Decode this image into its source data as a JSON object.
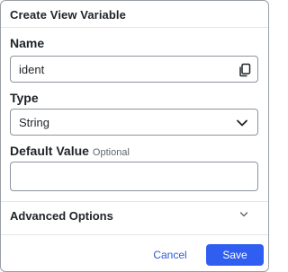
{
  "dialog": {
    "title": "Create View Variable"
  },
  "fields": {
    "name": {
      "label": "Name",
      "value": "ident",
      "icon": "copy-icon"
    },
    "type": {
      "label": "Type",
      "selected": "String",
      "icon": "chevron-down-icon"
    },
    "default_value": {
      "label": "Default Value",
      "hint": "Optional",
      "value": ""
    }
  },
  "advanced": {
    "label": "Advanced Options",
    "icon": "chevron-down-icon"
  },
  "footer": {
    "cancel_label": "Cancel",
    "save_label": "Save"
  },
  "colors": {
    "accent": "#2f5ef0",
    "link": "#2a5bd7",
    "border": "#8d949c"
  }
}
